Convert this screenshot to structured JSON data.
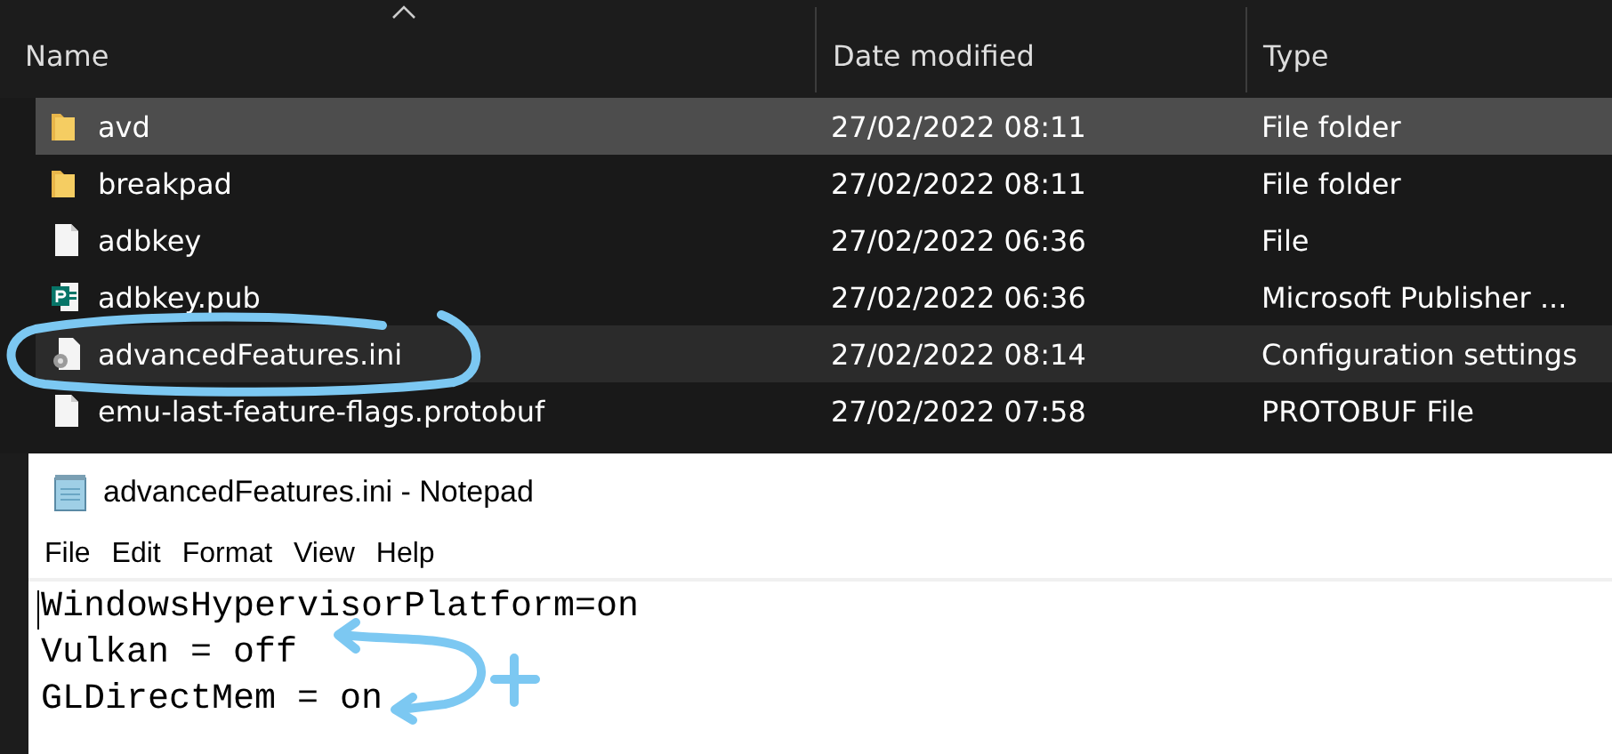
{
  "explorer": {
    "columns": [
      {
        "label": "Name",
        "sorted": true
      },
      {
        "label": "Date modified",
        "sorted": false
      },
      {
        "label": "Type",
        "sorted": false
      }
    ],
    "rows": [
      {
        "kind": "folder",
        "name": "avd",
        "date": "27/02/2022 08:11",
        "type": "File folder",
        "selected": true,
        "hovered": false
      },
      {
        "kind": "folder",
        "name": "breakpad",
        "date": "27/02/2022 08:11",
        "type": "File folder",
        "selected": false,
        "hovered": false
      },
      {
        "kind": "file",
        "name": "adbkey",
        "date": "27/02/2022 06:36",
        "type": "File",
        "selected": false,
        "hovered": false
      },
      {
        "kind": "publisher",
        "name": "adbkey.pub",
        "date": "27/02/2022 06:36",
        "type": "Microsoft Publisher ...",
        "selected": false,
        "hovered": false
      },
      {
        "kind": "settings",
        "name": "advancedFeatures.ini",
        "date": "27/02/2022 08:14",
        "type": "Configuration settings",
        "selected": false,
        "hovered": true
      },
      {
        "kind": "file",
        "name": "emu-last-feature-flags.protobuf",
        "date": "27/02/2022 07:58",
        "type": "PROTOBUF File",
        "selected": false,
        "hovered": false
      }
    ]
  },
  "notepad": {
    "title": "advancedFeatures.ini - Notepad",
    "menu": [
      "File",
      "Edit",
      "Format",
      "View",
      "Help"
    ],
    "lines": [
      "WindowsHypervisorPlatform=on",
      "Vulkan = off",
      "GLDirectMem = on"
    ]
  },
  "annotations": [
    {
      "kind": "ellipse"
    },
    {
      "kind": "curved-arrow"
    },
    {
      "kind": "plus"
    }
  ]
}
